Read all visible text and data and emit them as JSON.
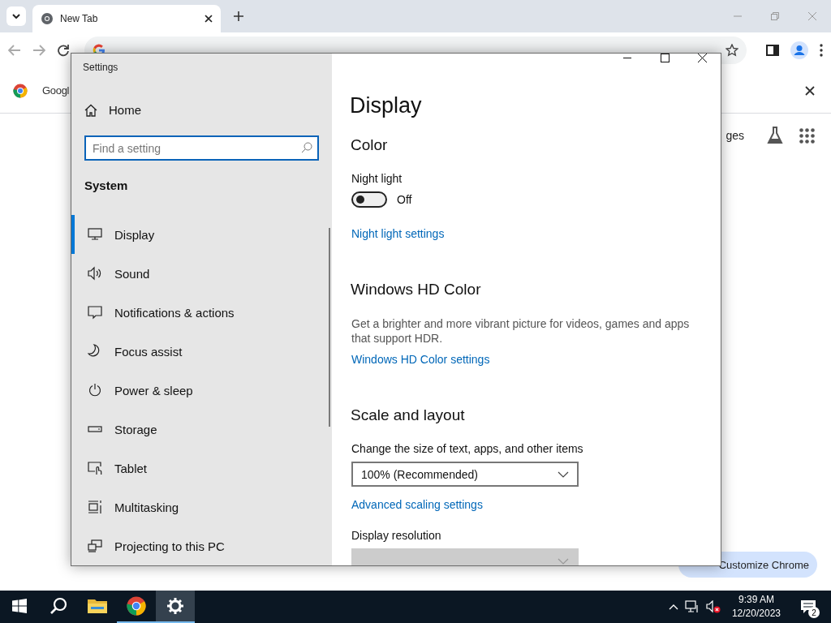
{
  "browser": {
    "tabs": [
      {
        "title": "New Tab",
        "selected": true
      }
    ],
    "info_bar": {
      "text": "Googl"
    },
    "page": {
      "shortcut_text": "ges",
      "customize_button": "Customize Chrome"
    }
  },
  "settings_window": {
    "title": "Settings",
    "home": "Home",
    "search": {
      "placeholder": "Find a setting"
    },
    "section": "System",
    "nav_items": [
      {
        "kind": "display",
        "label": "Display",
        "selected": true
      },
      {
        "kind": "sound",
        "label": "Sound",
        "selected": false
      },
      {
        "kind": "notifications",
        "label": "Notifications & actions",
        "selected": false
      },
      {
        "kind": "focus",
        "label": "Focus assist",
        "selected": false
      },
      {
        "kind": "power",
        "label": "Power & sleep",
        "selected": false
      },
      {
        "kind": "storage",
        "label": "Storage",
        "selected": false
      },
      {
        "kind": "tablet",
        "label": "Tablet",
        "selected": false
      },
      {
        "kind": "multitasking",
        "label": "Multitasking",
        "selected": false
      },
      {
        "kind": "projecting",
        "label": "Projecting to this PC",
        "selected": false
      }
    ],
    "page_title": "Display",
    "sections": [
      {
        "heading": "Color",
        "items": [
          {
            "kind": "toggle",
            "label": "Night light",
            "on": false,
            "state_text": "Off"
          },
          {
            "kind": "link",
            "text": "Night light settings"
          }
        ]
      },
      {
        "heading": "Windows HD Color",
        "items": [
          {
            "kind": "text",
            "text": "Get a brighter and more vibrant picture for videos, games and apps that support HDR."
          },
          {
            "kind": "link",
            "text": "Windows HD Color settings"
          }
        ]
      },
      {
        "heading": "Scale and layout",
        "items": [
          {
            "kind": "dropdown",
            "label": "Change the size of text, apps, and other items",
            "value": "100% (Recommended)",
            "disabled": false
          },
          {
            "kind": "link",
            "text": "Advanced scaling settings"
          },
          {
            "kind": "dropdown",
            "label": "Display resolution",
            "disabled": true
          }
        ]
      }
    ]
  },
  "taskbar": {
    "apps": [
      {
        "kind": "start",
        "running": false,
        "active": false
      },
      {
        "kind": "search",
        "running": false,
        "active": false
      },
      {
        "kind": "explorer",
        "running": false,
        "active": false
      },
      {
        "kind": "chrome",
        "running": true,
        "active": false
      },
      {
        "kind": "settings",
        "running": true,
        "active": true
      }
    ],
    "time": "9:39 AM",
    "date": "12/20/2023",
    "notification_count": "2"
  }
}
